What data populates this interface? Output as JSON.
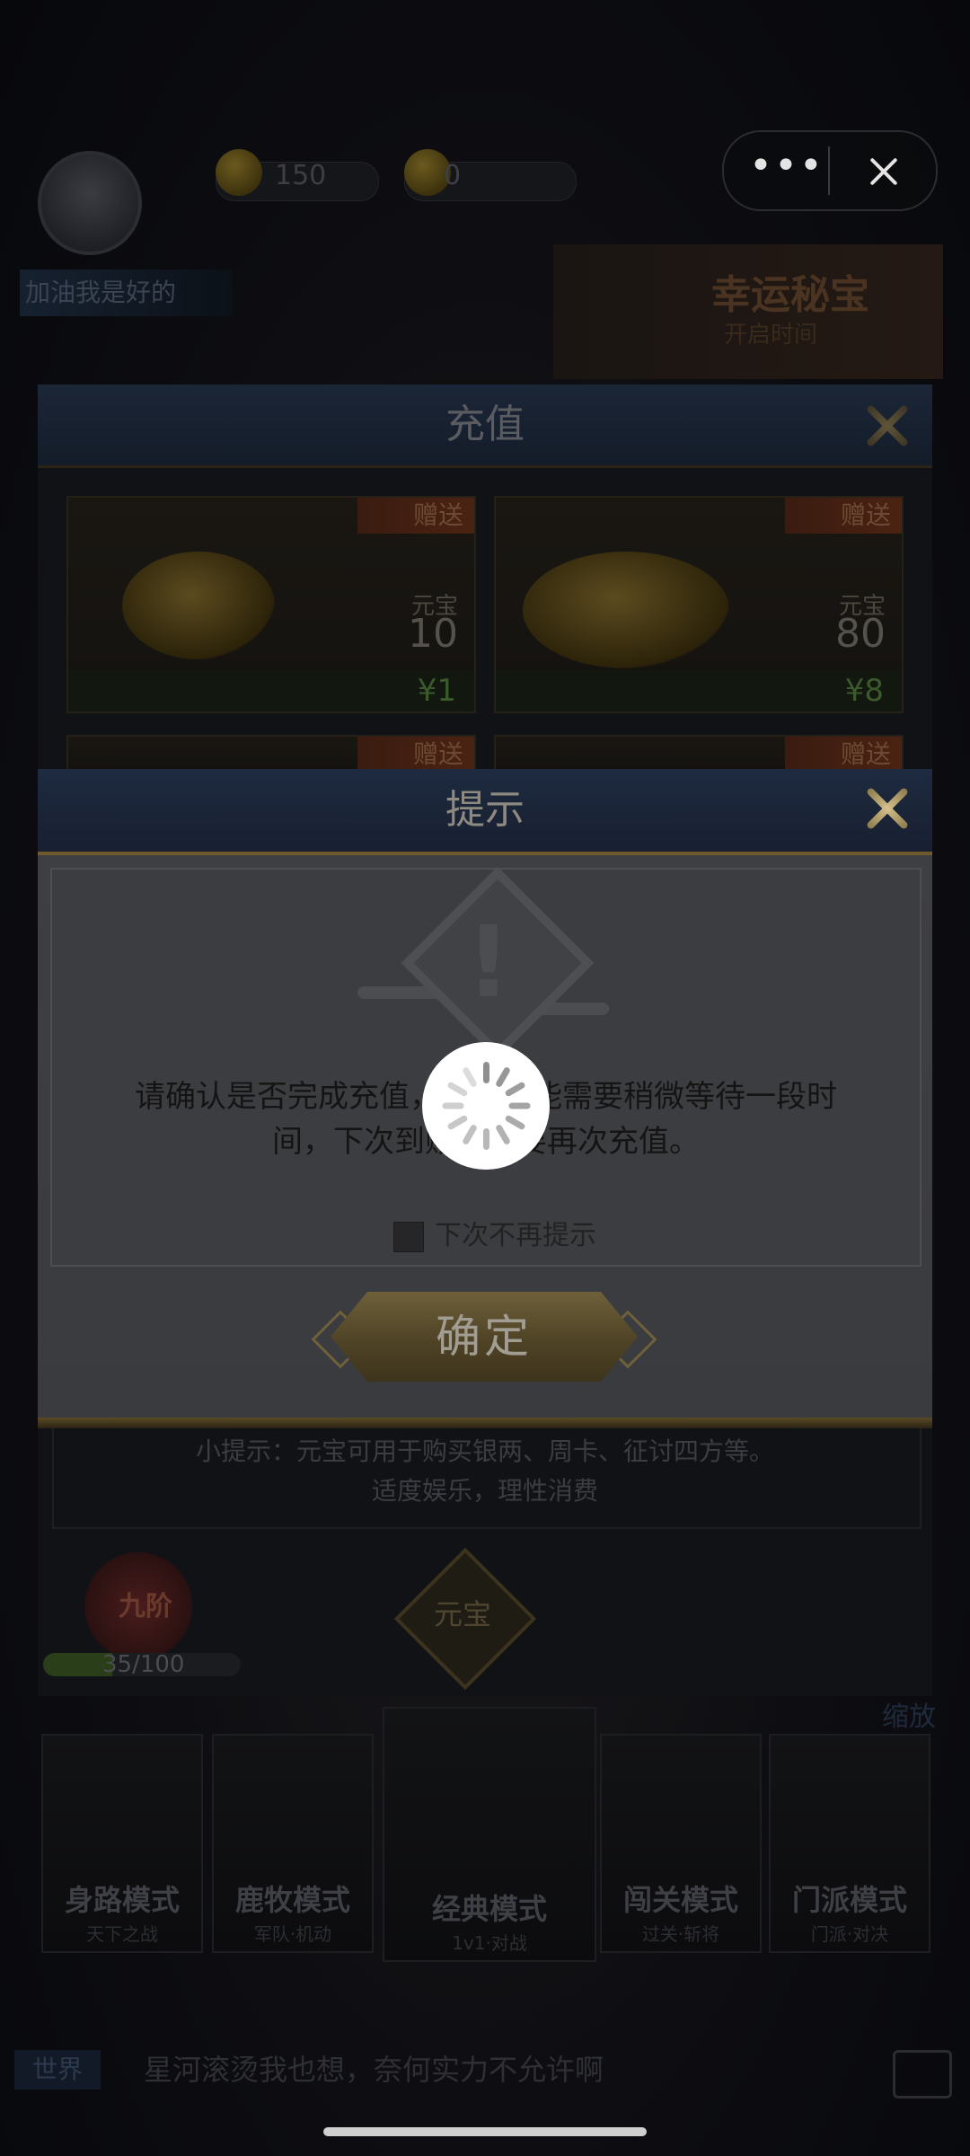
{
  "capsule": {
    "more_label": "•••"
  },
  "top_bar": {
    "silver": "150",
    "gold": "0",
    "username": "加油我是好的"
  },
  "banner": {
    "title": "幸运秘宝",
    "subtitle": "开启时间"
  },
  "recharge": {
    "title": "充值",
    "cards": [
      {
        "tag": "赠送",
        "unit": "元宝",
        "amount": "10",
        "price": "¥1"
      },
      {
        "tag": "赠送",
        "unit": "元宝",
        "amount": "80",
        "price": "¥8"
      },
      {
        "tag": "赠送"
      },
      {
        "tag": "赠送"
      }
    ],
    "tip_line1": "小提示：元宝可用于购买银两、周卡、征讨四方等。",
    "tip_line2": "适度娱乐，理性消费",
    "vip_label": "九阶",
    "vip_progress": "35/100",
    "vip_progress_fraction": 0.35,
    "currency_label": "元宝"
  },
  "modes": [
    {
      "title": "身路模式",
      "sub": "天下之战"
    },
    {
      "title": "鹿牧模式",
      "sub": "军队·机动"
    },
    {
      "title": "经典模式",
      "sub": "1v1·对战"
    },
    {
      "title": "闯关模式",
      "sub": "过关·斩将"
    },
    {
      "title": "门派模式",
      "sub": "门派·对决"
    }
  ],
  "zoom_label": "缩放",
  "chat": {
    "channel": "世界",
    "message": "星河滚烫我也想，奈何实力不允许啊"
  },
  "dialog": {
    "title": "提示",
    "message": "请确认是否完成充值，到账可能需要稍微等待一段时间，下次到账前不要再次充值。",
    "checkbox_label": "下次不再提示",
    "confirm_label": "确定"
  },
  "colors": {
    "accent_gold": "#d4c08a",
    "header_blue": "#1d2a40",
    "spinner_bg": "#ffffff"
  }
}
